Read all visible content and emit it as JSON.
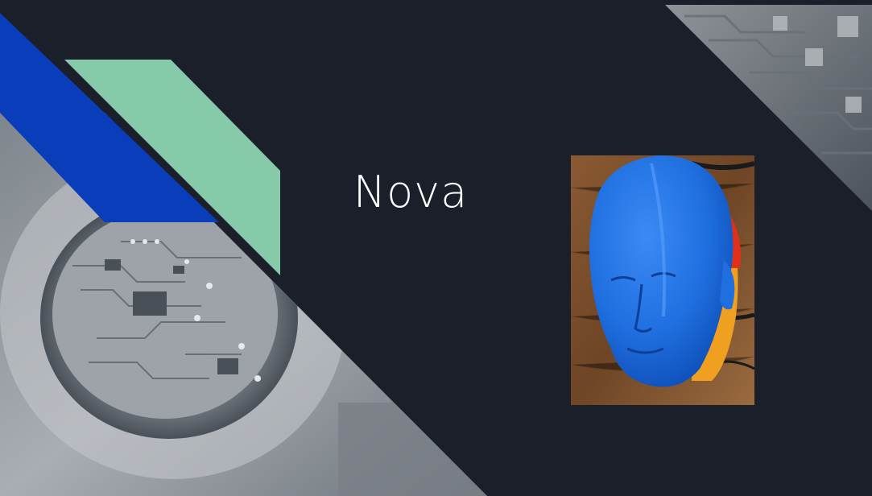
{
  "slide": {
    "title": "Nova"
  },
  "colors": {
    "background": "#1b1f2a",
    "accent_blue": "#0a3dba",
    "accent_mint": "#86caa9",
    "photo_panel_gray": "#8c9198",
    "head_blue": "#1f6fe0"
  },
  "images": {
    "circuit_board_photo": "circuit-board-in-lens",
    "pcb_texture_photo": "pcb-texture",
    "head_photo": "3d-printed-head"
  }
}
